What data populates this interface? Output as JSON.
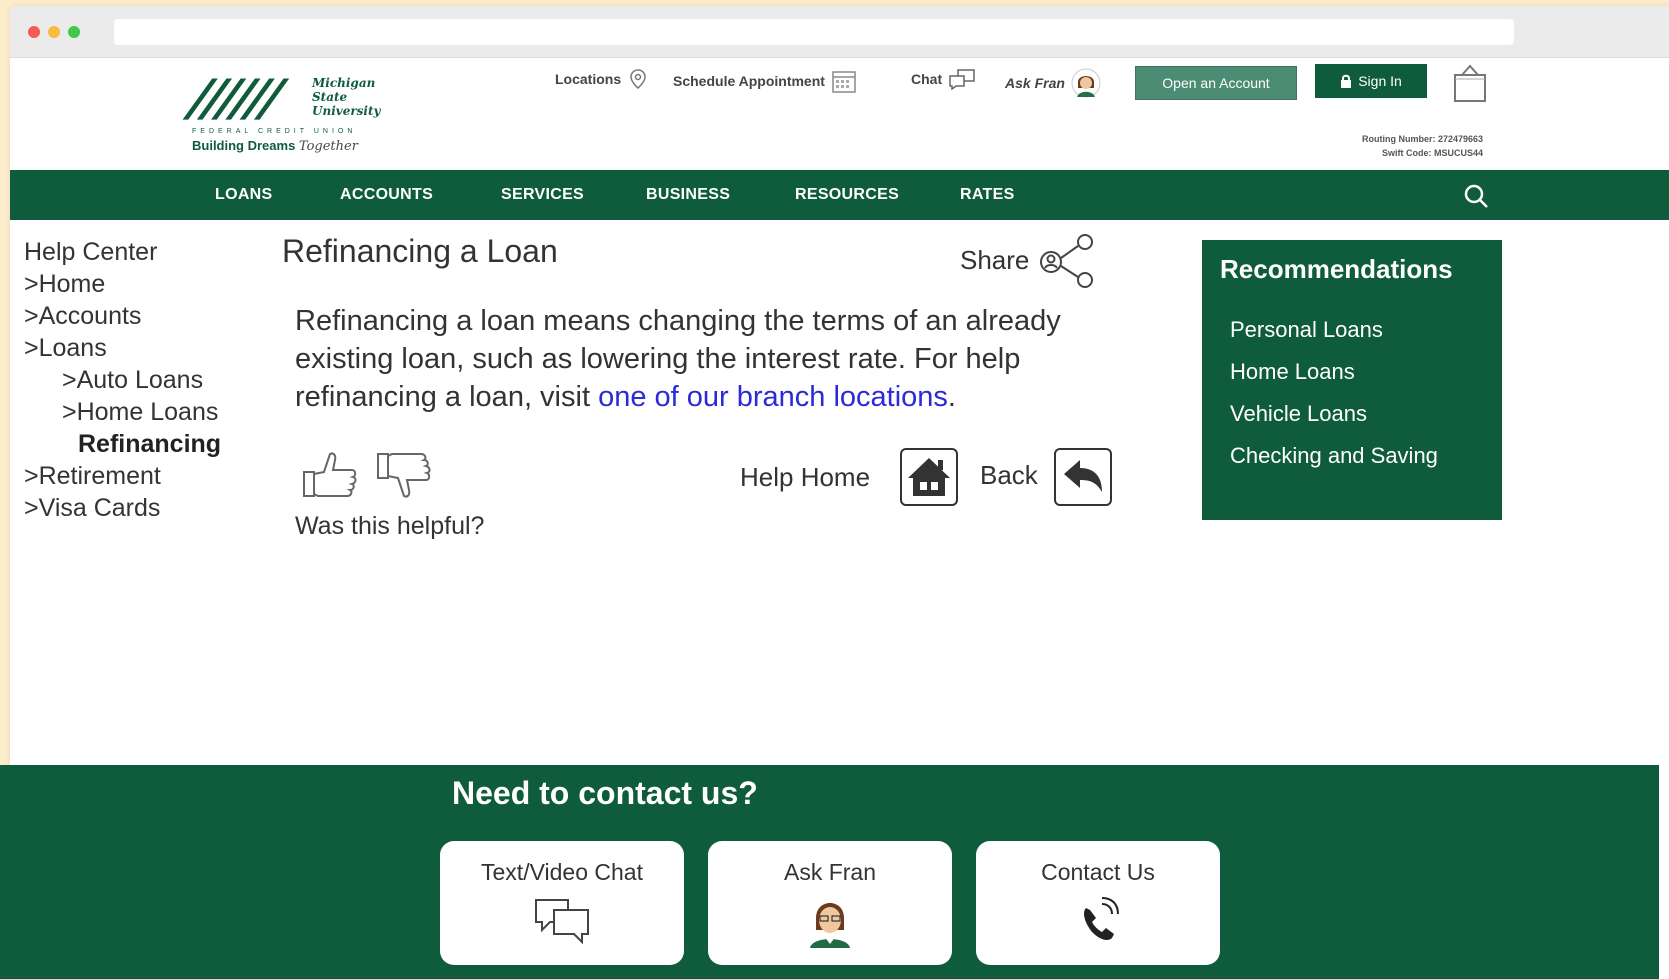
{
  "header": {
    "logo": {
      "name_lines": [
        "Michigan",
        "State",
        "University"
      ],
      "fcu_text": "FEDERAL CREDIT UNION",
      "tagline": "Building Dreams",
      "tagline_script": "Together"
    },
    "utility": {
      "locations": "Locations",
      "schedule": "Schedule Appointment",
      "chat": "Chat",
      "ask_fran": "Ask Fran"
    },
    "open_account": "Open an Account",
    "sign_in": "Sign In",
    "routing_number": "Routing Number: 272479663",
    "swift_code": "Swift Code: MSUCUS44"
  },
  "nav": {
    "items": [
      "LOANS",
      "ACCOUNTS",
      "SERVICES",
      "BUSINESS",
      "RESOURCES",
      "RATES"
    ]
  },
  "sidebar": {
    "items": [
      "Help Center",
      ">Home",
      ">Accounts",
      ">Loans",
      ">Auto Loans",
      ">Home Loans",
      "Refinancing",
      ">Retirement",
      ">Visa Cards"
    ]
  },
  "main": {
    "title": "Refinancing a Loan",
    "share": "Share",
    "body": "Refinancing a loan means changing the terms of an already existing loan, such as lowering the interest rate.  For help refinancing a loan, visit ",
    "link": "one of our branch locations",
    "body_end": ".",
    "helpful": "Was this helpful?",
    "help_home": "Help Home",
    "back": "Back"
  },
  "recommendations": {
    "title": "Recommendations",
    "items": [
      "Personal Loans",
      "Home Loans",
      "Vehicle Loans",
      "Checking and Saving"
    ]
  },
  "footer": {
    "heading": "Need to contact us?",
    "cards": [
      "Text/Video Chat",
      "Ask Fran",
      "Contact Us"
    ]
  },
  "colors": {
    "brand_green": "#0f5c3d",
    "button_green": "#4c8c74",
    "link_blue": "#2a2ad8",
    "page_bg": "#fbeccb"
  }
}
